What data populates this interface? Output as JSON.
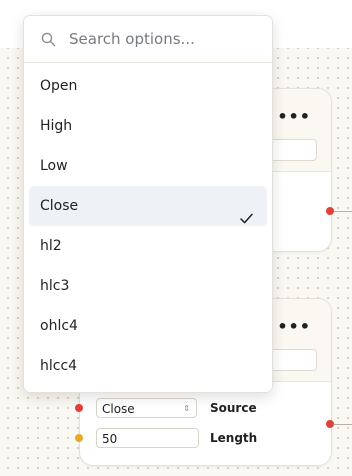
{
  "dropdown": {
    "search_placeholder": "Search options...",
    "options": [
      {
        "label": "Open",
        "selected": false
      },
      {
        "label": "High",
        "selected": false
      },
      {
        "label": "Low",
        "selected": false
      },
      {
        "label": "Close",
        "selected": true
      },
      {
        "label": "hl2",
        "selected": false
      },
      {
        "label": "hlc3",
        "selected": false
      },
      {
        "label": "ohlc4",
        "selected": false
      },
      {
        "label": "hlcc4",
        "selected": false
      }
    ]
  },
  "node_top": {
    "menu_icon": "more-horizontal-icon"
  },
  "node_bottom": {
    "menu_icon": "more-horizontal-icon",
    "source_value": "Close",
    "source_label": "Source",
    "length_value": "50",
    "length_label": "Length"
  },
  "colors": {
    "port_red": "#e0413c",
    "port_yellow": "#e8a92a",
    "selected_bg": "#eef1f5",
    "canvas_bg": "#faf8f2"
  }
}
